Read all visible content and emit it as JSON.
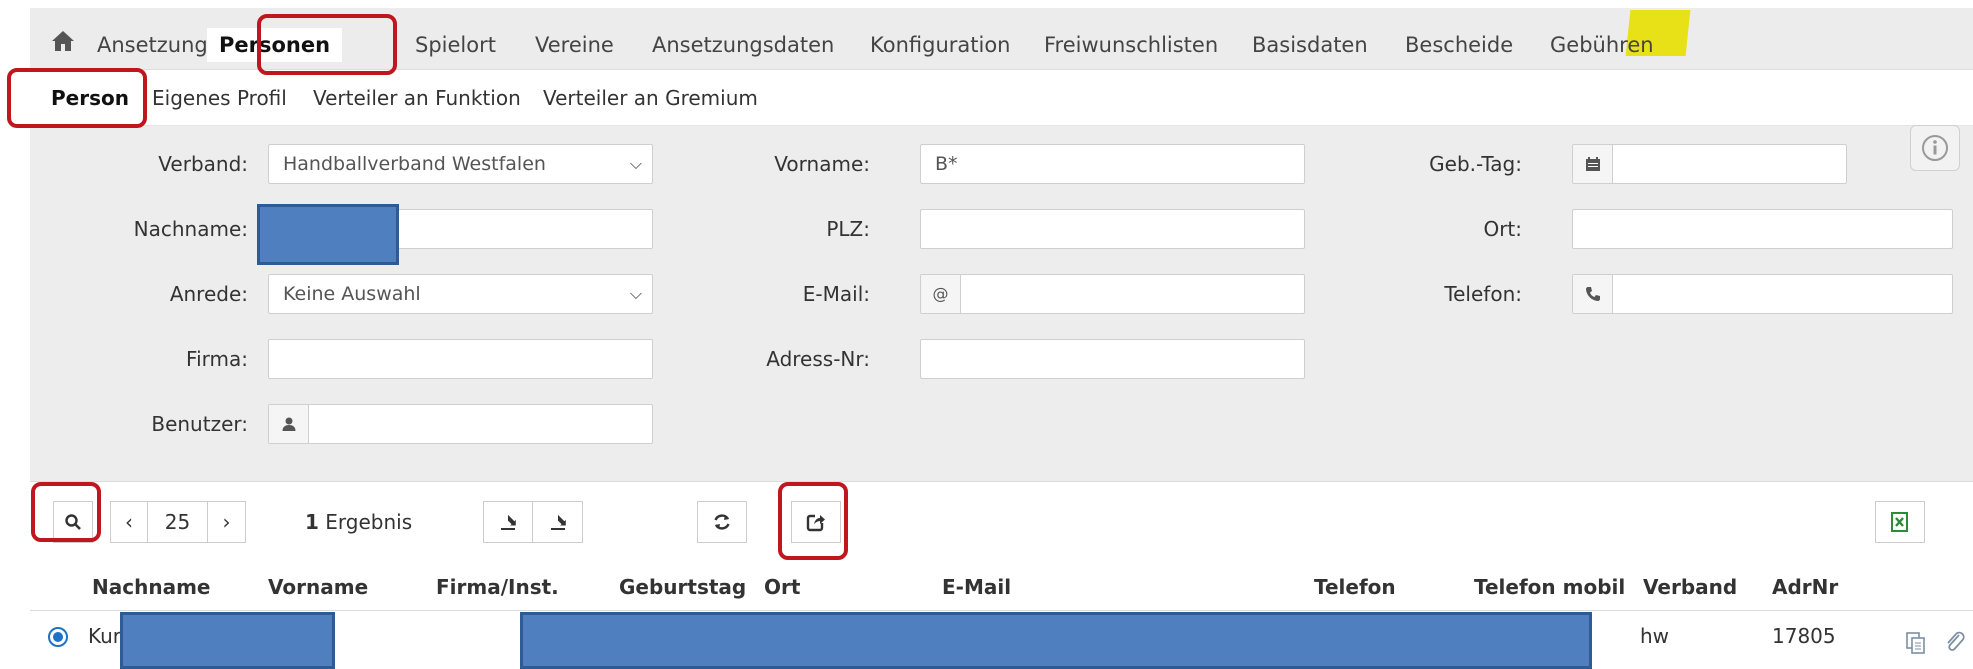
{
  "nav": {
    "tabs": [
      "Ansetzung",
      "Personen",
      "Spielort",
      "Vereine",
      "Ansetzungsdaten",
      "Konfiguration",
      "Freiwunschlisten",
      "Basisdaten",
      "Bescheide",
      "Gebühren"
    ],
    "home_icon": "home-icon"
  },
  "subnav": {
    "tabs": [
      "Person",
      "Eigenes Profil",
      "Verteiler an Funktion",
      "Verteiler an Gremium"
    ]
  },
  "form": {
    "verband_label": "Verband:",
    "verband_value": "Handballverband Westfalen",
    "vorname_label": "Vorname:",
    "vorname_value": "B*",
    "gebtag_label": "Geb.-Tag:",
    "nachname_label": "Nachname:",
    "plz_label": "PLZ:",
    "ort_label": "Ort:",
    "anrede_label": "Anrede:",
    "anrede_value": "Keine Auswahl",
    "email_label": "E-Mail:",
    "email_addon": "@",
    "telefon_label": "Telefon:",
    "firma_label": "Firma:",
    "adressnr_label": "Adress-Nr:",
    "benutzer_label": "Benutzer:"
  },
  "toolbar": {
    "page_size": "25",
    "result_count": "1",
    "result_text": "Ergebnis"
  },
  "table": {
    "columns": [
      "Nachname",
      "Vorname",
      "Firma/Inst.",
      "Geburtstag",
      "Ort",
      "E-Mail",
      "Telefon",
      "Telefon mobil",
      "Verband",
      "AdrNr"
    ],
    "rows": [
      {
        "nachname": "Kur",
        "verband": "hw",
        "adrnr": "17805"
      }
    ]
  },
  "colors": {
    "active_tab_outline": "#c0171f",
    "highlight": "#e8e000",
    "redaction": "#4f7fbf",
    "radio": "#1a73c9"
  }
}
